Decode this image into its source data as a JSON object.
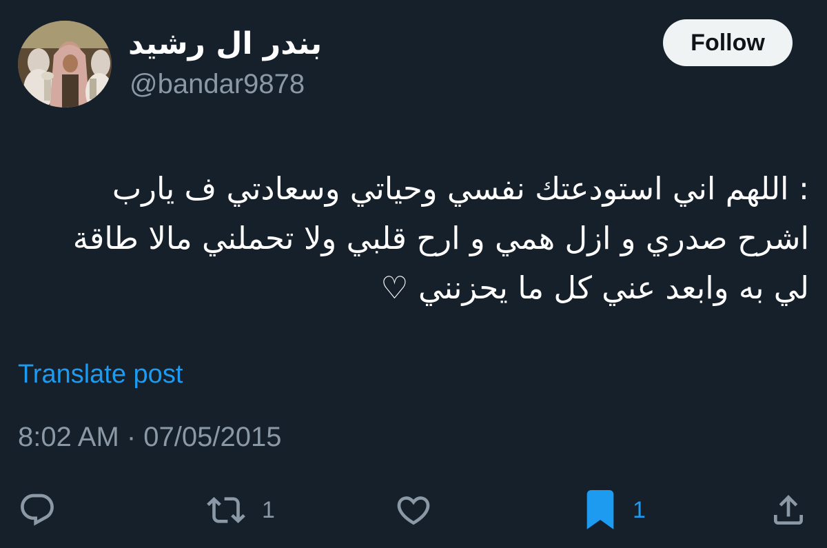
{
  "author": {
    "display_name": "بندر ال رشيد",
    "handle": "@bandar9878"
  },
  "follow_label": "Follow",
  "tweet": {
    "lines": [
      ": اللهم اني استودعتك نفسي  وحياتي وسعادتي ف يارب",
      "اشرح  صدري و ازل همي و ارح قلبي ولا تحملني مالا طاقة",
      "لي به وابعد عني كل ما يحزنني ♡"
    ]
  },
  "translate_label": "Translate post",
  "timestamp": "8:02 AM · 07/05/2015",
  "actions": {
    "reply": {
      "icon": "reply-icon",
      "count": ""
    },
    "retweet": {
      "icon": "retweet-icon",
      "count": "1"
    },
    "like": {
      "icon": "heart-icon",
      "count": ""
    },
    "bookmark": {
      "icon": "bookmark-icon",
      "count": "1",
      "active": true
    },
    "share": {
      "icon": "share-icon",
      "count": ""
    }
  },
  "colors": {
    "background": "#15202b",
    "text": "#ffffff",
    "secondary_text": "#8b98a5",
    "accent": "#1d9bf0",
    "follow_bg": "#eff3f4"
  }
}
